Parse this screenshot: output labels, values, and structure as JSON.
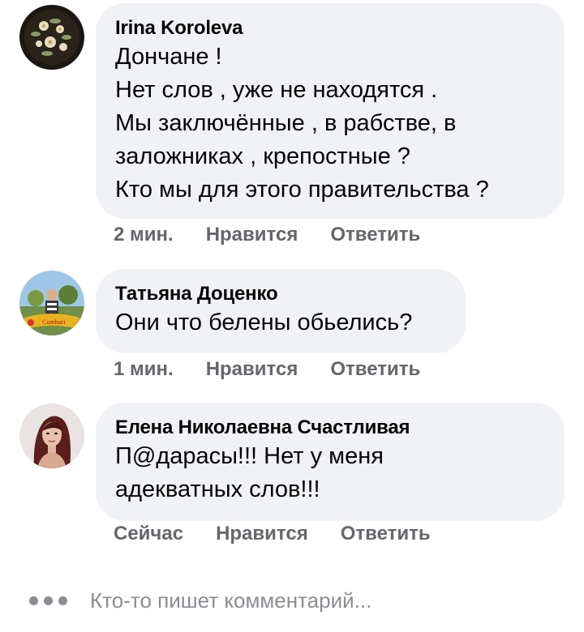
{
  "comments": [
    {
      "author": "Irina Koroleva",
      "lines": [
        "Дончане !",
        "Нет слов , уже не находятся .",
        "Мы заключённые , в рабстве, в",
        "заложниках , крепостные ?",
        "Кто мы для этого правительства ?"
      ],
      "time": "2 мин.",
      "like_label": "Нравится",
      "reply_label": "Ответить"
    },
    {
      "author": "Татьяна Доценко",
      "lines": [
        "Они что белены обьелись?"
      ],
      "time": "1 мин.",
      "like_label": "Нравится",
      "reply_label": "Ответить",
      "avatar_text": "Cumhuri"
    },
    {
      "author": "Елена Николаевна Счастливая",
      "lines": [
        "П@дарасы!!! Нет у меня",
        "адекватных слов!!!"
      ],
      "time": "Сейчас",
      "like_label": "Нравится",
      "reply_label": "Ответить"
    }
  ],
  "typing_indicator": {
    "icon": "typing-dots-icon",
    "text": "Кто-то пишет комментарий..."
  },
  "colors": {
    "bubble": "#f0f2f5",
    "secondary_text": "#65676b",
    "primary_text": "#050505"
  }
}
